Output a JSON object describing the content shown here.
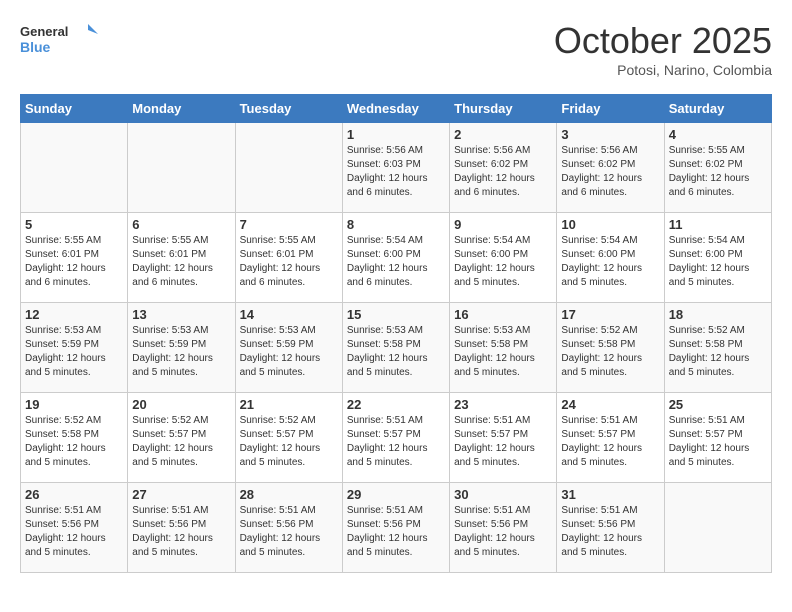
{
  "header": {
    "logo_general": "General",
    "logo_blue": "Blue",
    "month": "October 2025",
    "location": "Potosi, Narino, Colombia"
  },
  "days_of_week": [
    "Sunday",
    "Monday",
    "Tuesday",
    "Wednesday",
    "Thursday",
    "Friday",
    "Saturday"
  ],
  "weeks": [
    [
      {
        "day": "",
        "info": ""
      },
      {
        "day": "",
        "info": ""
      },
      {
        "day": "",
        "info": ""
      },
      {
        "day": "1",
        "info": "Sunrise: 5:56 AM\nSunset: 6:03 PM\nDaylight: 12 hours\nand 6 minutes."
      },
      {
        "day": "2",
        "info": "Sunrise: 5:56 AM\nSunset: 6:02 PM\nDaylight: 12 hours\nand 6 minutes."
      },
      {
        "day": "3",
        "info": "Sunrise: 5:56 AM\nSunset: 6:02 PM\nDaylight: 12 hours\nand 6 minutes."
      },
      {
        "day": "4",
        "info": "Sunrise: 5:55 AM\nSunset: 6:02 PM\nDaylight: 12 hours\nand 6 minutes."
      }
    ],
    [
      {
        "day": "5",
        "info": "Sunrise: 5:55 AM\nSunset: 6:01 PM\nDaylight: 12 hours\nand 6 minutes."
      },
      {
        "day": "6",
        "info": "Sunrise: 5:55 AM\nSunset: 6:01 PM\nDaylight: 12 hours\nand 6 minutes."
      },
      {
        "day": "7",
        "info": "Sunrise: 5:55 AM\nSunset: 6:01 PM\nDaylight: 12 hours\nand 6 minutes."
      },
      {
        "day": "8",
        "info": "Sunrise: 5:54 AM\nSunset: 6:00 PM\nDaylight: 12 hours\nand 6 minutes."
      },
      {
        "day": "9",
        "info": "Sunrise: 5:54 AM\nSunset: 6:00 PM\nDaylight: 12 hours\nand 5 minutes."
      },
      {
        "day": "10",
        "info": "Sunrise: 5:54 AM\nSunset: 6:00 PM\nDaylight: 12 hours\nand 5 minutes."
      },
      {
        "day": "11",
        "info": "Sunrise: 5:54 AM\nSunset: 6:00 PM\nDaylight: 12 hours\nand 5 minutes."
      }
    ],
    [
      {
        "day": "12",
        "info": "Sunrise: 5:53 AM\nSunset: 5:59 PM\nDaylight: 12 hours\nand 5 minutes."
      },
      {
        "day": "13",
        "info": "Sunrise: 5:53 AM\nSunset: 5:59 PM\nDaylight: 12 hours\nand 5 minutes."
      },
      {
        "day": "14",
        "info": "Sunrise: 5:53 AM\nSunset: 5:59 PM\nDaylight: 12 hours\nand 5 minutes."
      },
      {
        "day": "15",
        "info": "Sunrise: 5:53 AM\nSunset: 5:58 PM\nDaylight: 12 hours\nand 5 minutes."
      },
      {
        "day": "16",
        "info": "Sunrise: 5:53 AM\nSunset: 5:58 PM\nDaylight: 12 hours\nand 5 minutes."
      },
      {
        "day": "17",
        "info": "Sunrise: 5:52 AM\nSunset: 5:58 PM\nDaylight: 12 hours\nand 5 minutes."
      },
      {
        "day": "18",
        "info": "Sunrise: 5:52 AM\nSunset: 5:58 PM\nDaylight: 12 hours\nand 5 minutes."
      }
    ],
    [
      {
        "day": "19",
        "info": "Sunrise: 5:52 AM\nSunset: 5:58 PM\nDaylight: 12 hours\nand 5 minutes."
      },
      {
        "day": "20",
        "info": "Sunrise: 5:52 AM\nSunset: 5:57 PM\nDaylight: 12 hours\nand 5 minutes."
      },
      {
        "day": "21",
        "info": "Sunrise: 5:52 AM\nSunset: 5:57 PM\nDaylight: 12 hours\nand 5 minutes."
      },
      {
        "day": "22",
        "info": "Sunrise: 5:51 AM\nSunset: 5:57 PM\nDaylight: 12 hours\nand 5 minutes."
      },
      {
        "day": "23",
        "info": "Sunrise: 5:51 AM\nSunset: 5:57 PM\nDaylight: 12 hours\nand 5 minutes."
      },
      {
        "day": "24",
        "info": "Sunrise: 5:51 AM\nSunset: 5:57 PM\nDaylight: 12 hours\nand 5 minutes."
      },
      {
        "day": "25",
        "info": "Sunrise: 5:51 AM\nSunset: 5:57 PM\nDaylight: 12 hours\nand 5 minutes."
      }
    ],
    [
      {
        "day": "26",
        "info": "Sunrise: 5:51 AM\nSunset: 5:56 PM\nDaylight: 12 hours\nand 5 minutes."
      },
      {
        "day": "27",
        "info": "Sunrise: 5:51 AM\nSunset: 5:56 PM\nDaylight: 12 hours\nand 5 minutes."
      },
      {
        "day": "28",
        "info": "Sunrise: 5:51 AM\nSunset: 5:56 PM\nDaylight: 12 hours\nand 5 minutes."
      },
      {
        "day": "29",
        "info": "Sunrise: 5:51 AM\nSunset: 5:56 PM\nDaylight: 12 hours\nand 5 minutes."
      },
      {
        "day": "30",
        "info": "Sunrise: 5:51 AM\nSunset: 5:56 PM\nDaylight: 12 hours\nand 5 minutes."
      },
      {
        "day": "31",
        "info": "Sunrise: 5:51 AM\nSunset: 5:56 PM\nDaylight: 12 hours\nand 5 minutes."
      },
      {
        "day": "",
        "info": ""
      }
    ]
  ]
}
